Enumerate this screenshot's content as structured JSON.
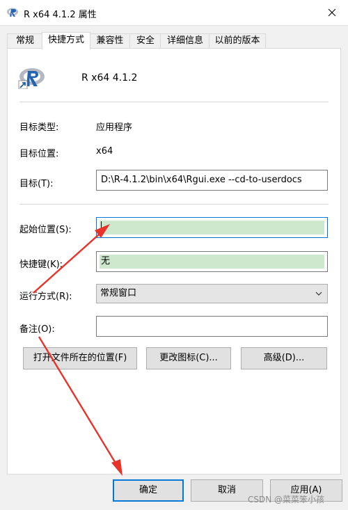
{
  "window": {
    "title": "R x64 4.1.2 属性",
    "title_icon": "r-logo-icon",
    "close_icon": "close-icon"
  },
  "tabs": [
    {
      "label": "常规",
      "active": false
    },
    {
      "label": "快捷方式",
      "active": true
    },
    {
      "label": "兼容性",
      "active": false
    },
    {
      "label": "安全",
      "active": false
    },
    {
      "label": "详细信息",
      "active": false
    },
    {
      "label": "以前的版本",
      "active": false
    }
  ],
  "app": {
    "name": "R x64 4.1.2",
    "icon": "r-logo-icon"
  },
  "fields": {
    "target_type": {
      "label": "目标类型:",
      "value": "应用程序"
    },
    "target_location": {
      "label": "目标位置:",
      "value": "x64"
    },
    "target": {
      "label": "目标(T):",
      "value": "D:\\R-4.1.2\\bin\\x64\\Rgui.exe --cd-to-userdocs"
    },
    "start_in": {
      "label": "起始位置(S):",
      "value": ""
    },
    "shortcut_key": {
      "label": "快捷键(K):",
      "value": "无"
    },
    "run": {
      "label": "运行方式(R):",
      "value": "常规窗口"
    },
    "comment": {
      "label": "备注(O):",
      "value": ""
    }
  },
  "buttons": {
    "open_location": "打开文件所在的位置(F)",
    "change_icon": "更改图标(C)...",
    "advanced": "高级(D)...",
    "ok": "确定",
    "cancel": "取消",
    "apply": "应用(A)"
  },
  "watermark": "CSDN @菜菜笨小孩",
  "colors": {
    "accent": "#0078d7",
    "highlight": "#cde8cd",
    "arrow": "#e8322a"
  }
}
